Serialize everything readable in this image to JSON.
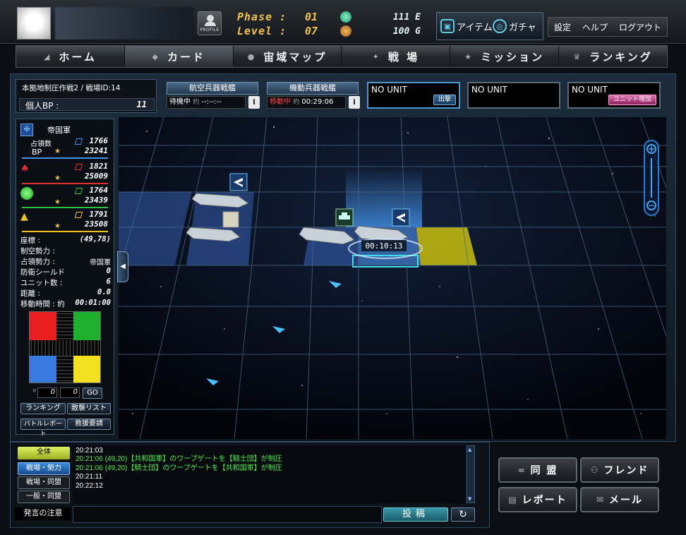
{
  "header": {
    "profile_label": "PROFILE",
    "phase_label": "Phase :",
    "phase_value": "01",
    "level_label": "Level :",
    "level_value": "07",
    "energy_value": "111 E",
    "gold_value": "100 G",
    "item_label": "アイテム",
    "gacha_label": "ガチャ",
    "settings_label": "設定",
    "help_label": "ヘルプ",
    "logout_label": "ログアウト"
  },
  "nav": [
    {
      "label": "ホーム",
      "icon": "home-icon"
    },
    {
      "label": "カード",
      "icon": "card-icon"
    },
    {
      "label": "宙域マップ",
      "icon": "planet-icon"
    },
    {
      "label": "戦 場",
      "icon": "battle-icon"
    },
    {
      "label": "ミッション",
      "icon": "star-icon"
    },
    {
      "label": "ランキング",
      "icon": "crown-icon"
    }
  ],
  "battle_info": {
    "title": "本拠地制圧作戦2 / 戦場ID:14",
    "bp_label": "個人BP :",
    "bp_value": "11"
  },
  "fleets": [
    {
      "name": "航空兵器戦艦",
      "status": "待機中",
      "time_prefix": "約",
      "time": "--:--:--"
    },
    {
      "name": "機動兵器戦艦",
      "status": "移動中",
      "time_prefix": "約",
      "time": "00:29:06"
    }
  ],
  "unit_slots": [
    {
      "label": "NO UNIT",
      "button": "出撃"
    },
    {
      "label": "NO UNIT",
      "button": ""
    },
    {
      "label": "NO UNIT",
      "button": "ユニット増加"
    }
  ],
  "factions": {
    "empire_label": "帝国軍",
    "occupy_label": "占領数",
    "bp_label": "BP",
    "list": [
      {
        "v1": "1766",
        "v2": "23241",
        "color": "#3a8ef0"
      },
      {
        "v1": "1821",
        "v2": "25009",
        "color": "#e03030"
      },
      {
        "v1": "1764",
        "v2": "23439",
        "color": "#30c040"
      },
      {
        "v1": "1791",
        "v2": "23508",
        "color": "#f0c020"
      }
    ]
  },
  "tile_info": {
    "coord_label": "座標 :",
    "coord_value": "(49,78)",
    "air_label": "制空勢力 :",
    "air_value": "",
    "occupy_label": "占領勢力 :",
    "occupy_value": "帝国軍",
    "shield_label": "防衛シールド",
    "shield_value": "0",
    "units_label": "ユニット数 :",
    "units_value": "6",
    "distance_label": "距離 :",
    "distance_value": "0.0",
    "move_label": "移動時間 : 約",
    "move_value": "00:01:00"
  },
  "coord_input": {
    "x": "0",
    "y": "0",
    "go": "GO"
  },
  "side_buttons": {
    "ranking": "ランキング",
    "enemy_list": "敵襲リスト",
    "battle_report": "バトルレポート",
    "rescue": "救援要請"
  },
  "map": {
    "timer": "00:10:13"
  },
  "chat": {
    "tabs": [
      "全体",
      "戦場・勢力",
      "戦場・同盟",
      "一般・同盟",
      "発言の注意"
    ],
    "log": [
      {
        "time": "20:21:03",
        "text": "",
        "color": "#ffffff"
      },
      {
        "time": "20:21:06",
        "text": "(49,20)【共和国軍】のワープゲートを【騎士団】が制圧",
        "color": "#4af04a"
      },
      {
        "time": "20:21:06",
        "text": "(49,20)【騎士団】のワープゲートを【共和国軍】が制圧",
        "color": "#4af04a"
      },
      {
        "time": "20:21:11",
        "text": "",
        "color": "#ffffff"
      },
      {
        "time": "20:22:12",
        "text": "",
        "color": "#ffffff"
      }
    ],
    "post_label": "投稿",
    "refresh_icon": "↻"
  },
  "social": {
    "alliance": "同 盟",
    "friend": "フレンド",
    "report": "レポート",
    "mail": "メール"
  }
}
